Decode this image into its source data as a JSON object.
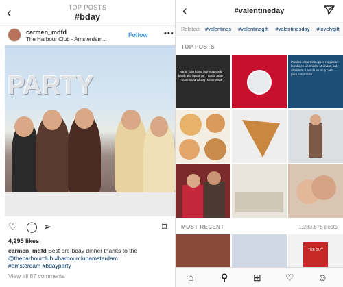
{
  "left": {
    "header": {
      "subtitle": "TOP POSTS",
      "title": "#bday"
    },
    "post": {
      "username": "carmen_mdfd",
      "location": "The Harbour Club - Amsterdam...",
      "follow_label": "Follow",
      "photo_text": "PARTY",
      "likes": "4,295 likes",
      "caption_user": "carmen_mdfd",
      "caption_text": " Best pre-bday dinner thanks to the ",
      "caption_tag1": "@theharbourclub",
      "caption_tag2": " #harbourclubamsterdam",
      "caption_tag3": "#amsterdam",
      "caption_tag4": " #bdayparty",
      "comments": "View all 87 comments"
    }
  },
  "right": {
    "header": {
      "title": "#valentineday"
    },
    "related": {
      "label": "Related:",
      "tags": [
        "#valentines",
        "#valentinegift",
        "#valentinesday",
        "#lovelygift"
      ]
    },
    "top_posts_label": "TOP POSTS",
    "most_recent_label": "MOST RECENT",
    "most_recent_count": "1,283,875 posts",
    "tiles": {
      "t1_text": "\"Nanti, kalo kamu lagi ngambek, kasih aku tanda ya\" \"Tanda apa?\" \"Phone saya tolong nomor anak\"",
      "t3_text": "Puedes estar triste, pero no pasar la vida en un rincón. Muévete, sal, diviértete. La vida es muy corta para estar triste",
      "t12_text": "THE GUY"
    }
  },
  "colors": {
    "link": "#003569",
    "follow": "#3897f0",
    "muted": "#8e8e8e"
  }
}
